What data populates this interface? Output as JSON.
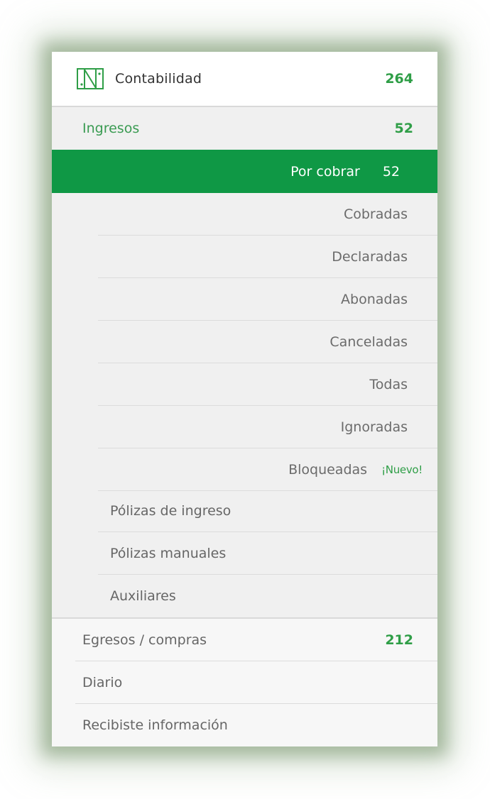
{
  "header": {
    "title": "Contabilidad",
    "count": "264",
    "icon": "ledger-icon"
  },
  "ingresos": {
    "label": "Ingresos",
    "count": "52"
  },
  "active_item": {
    "label": "Por cobrar",
    "count": "52"
  },
  "status_items": [
    {
      "label": "Cobradas"
    },
    {
      "label": "Declaradas"
    },
    {
      "label": "Abonadas"
    },
    {
      "label": "Canceladas"
    },
    {
      "label": "Todas"
    },
    {
      "label": "Ignoradas"
    },
    {
      "label": "Bloqueadas",
      "badge": "¡Nuevo!"
    }
  ],
  "ingresos_links": [
    {
      "label": "Pólizas de ingreso"
    },
    {
      "label": "Pólizas manuales"
    },
    {
      "label": "Auxiliares"
    }
  ],
  "sections": [
    {
      "label": "Egresos / compras",
      "count": "212"
    },
    {
      "label": "Diario"
    },
    {
      "label": "Recibiste información"
    }
  ],
  "colors": {
    "accent": "#0f9845",
    "count_green": "#2f9e47",
    "panel_bg": "#f0f0f0"
  }
}
